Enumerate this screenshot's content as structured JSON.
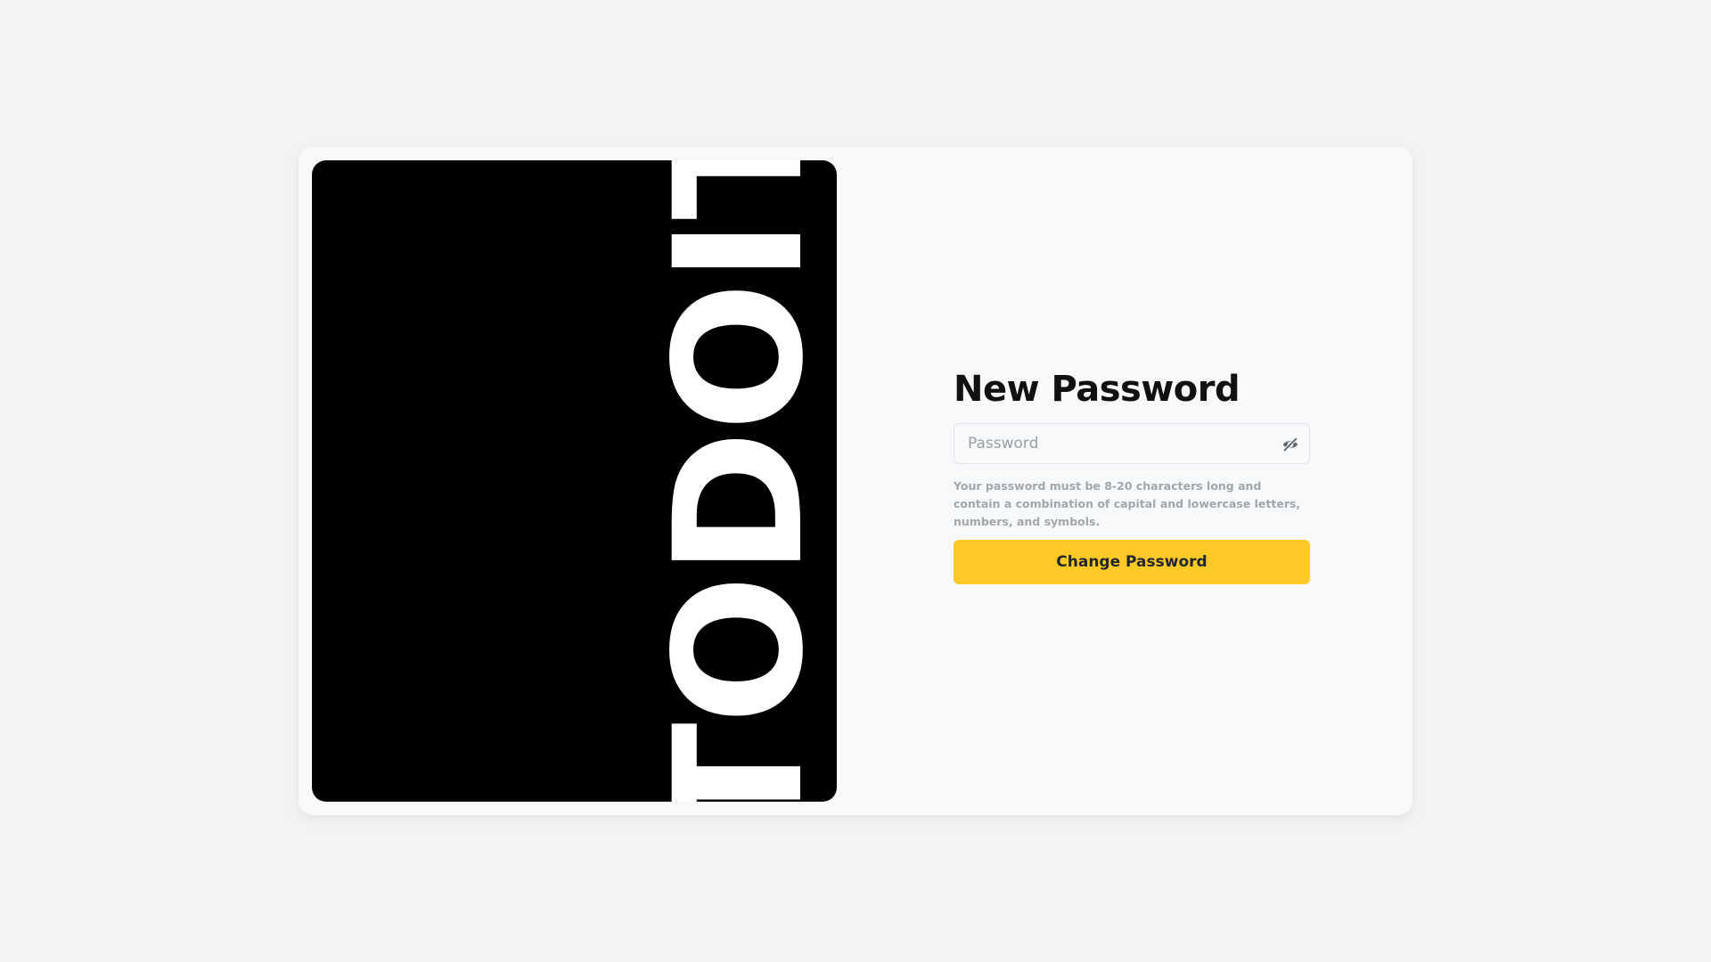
{
  "brand": {
    "wordmark": "TODOIT"
  },
  "form": {
    "title": "New Password",
    "password_placeholder": "Password",
    "password_value": "",
    "hint": "Your password must be 8-20 characters long and contain a combination of capital and lowercase letters, numbers, and symbols.",
    "submit_label": "Change Password",
    "toggle_icon": "eye-slash-icon"
  },
  "colors": {
    "background": "#f2f3f5",
    "card": "#f8f9fa",
    "brand_panel": "#000000",
    "accent": "#ffca28",
    "hint_text": "#a2a6ad"
  }
}
